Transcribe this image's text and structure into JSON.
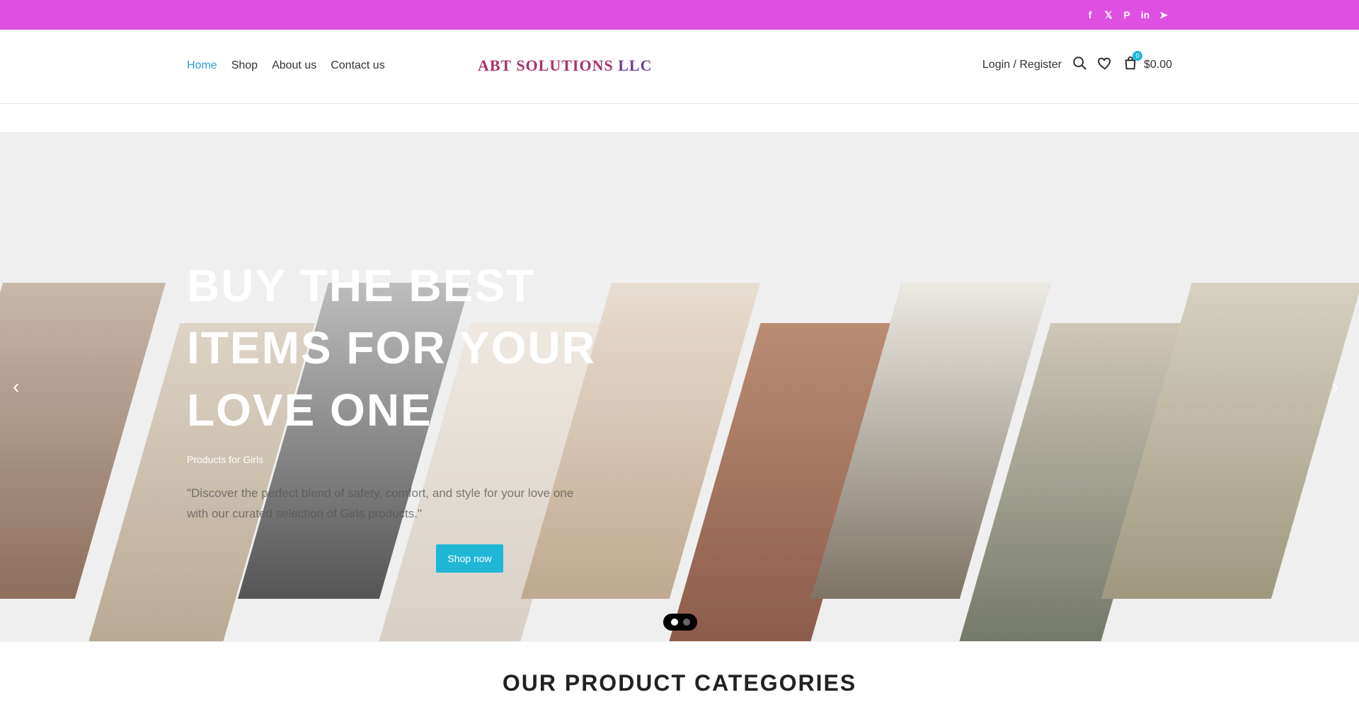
{
  "social": {
    "facebook": "f",
    "x": "𝕏",
    "pinterest": "P",
    "linkedin": "in",
    "telegram": "➤"
  },
  "nav": {
    "items": [
      "Home",
      "Shop",
      "About us",
      "Contact us"
    ]
  },
  "logo": {
    "part1": "ABT SOLUTIONS ",
    "part2": "LLC"
  },
  "header_right": {
    "login": "Login / Register",
    "cart_count": "0",
    "cart_total": "$0.00"
  },
  "hero": {
    "title": "BUY THE BEST ITEMS FOR YOUR LOVE ONE",
    "subtitle": "Products for Girls",
    "description": "\"Discover the perfect blend of safety, comfort, and style for your love one with our curated selection of Girls products.\"",
    "button": "Shop now",
    "slides": 2,
    "active_slide": 1
  },
  "categories": {
    "title": "OUR PRODUCT CATEGORIES"
  },
  "colors": {
    "topbar": "#dd50e1",
    "accent": "#20b7d6",
    "nav_active": "#2a9fd6"
  }
}
